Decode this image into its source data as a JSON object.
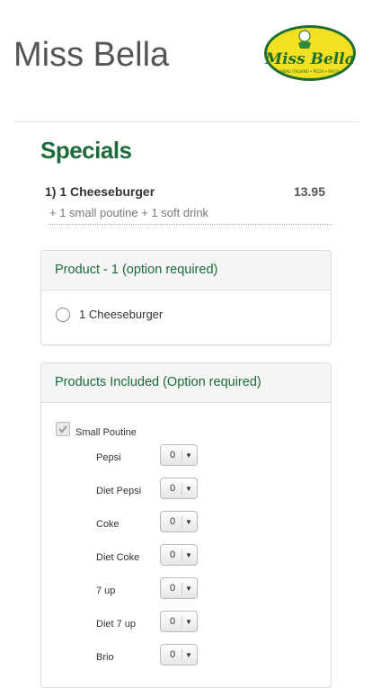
{
  "header": {
    "site_title": "Miss Bella",
    "logo_alt": "Miss Bella"
  },
  "section": {
    "title": "Specials"
  },
  "item": {
    "name": "1) 1 Cheeseburger",
    "price": "13.95",
    "description": "+ 1 small poutine + 1 soft drink"
  },
  "product_panel": {
    "title": "Product - 1 (option required)",
    "options": [
      {
        "label": "1 Cheeseburger",
        "selected": false
      }
    ]
  },
  "included_panel": {
    "title": "Products Included (Option required)",
    "checkbox_label": "Small Poutine",
    "checkbox_checked": true,
    "drinks": [
      {
        "label": "Pepsi",
        "qty": "0"
      },
      {
        "label": "Diet Pepsi",
        "qty": "0"
      },
      {
        "label": "Coke",
        "qty": "0"
      },
      {
        "label": "Diet Coke",
        "qty": "0"
      },
      {
        "label": "7 up",
        "qty": "0"
      },
      {
        "label": "Diet 7 up",
        "qty": "0"
      },
      {
        "label": "Brio",
        "qty": "0"
      }
    ]
  },
  "colors": {
    "accent": "#1d6b3a",
    "logo_yellow": "#f3e021",
    "logo_green": "#1f6e2f"
  }
}
